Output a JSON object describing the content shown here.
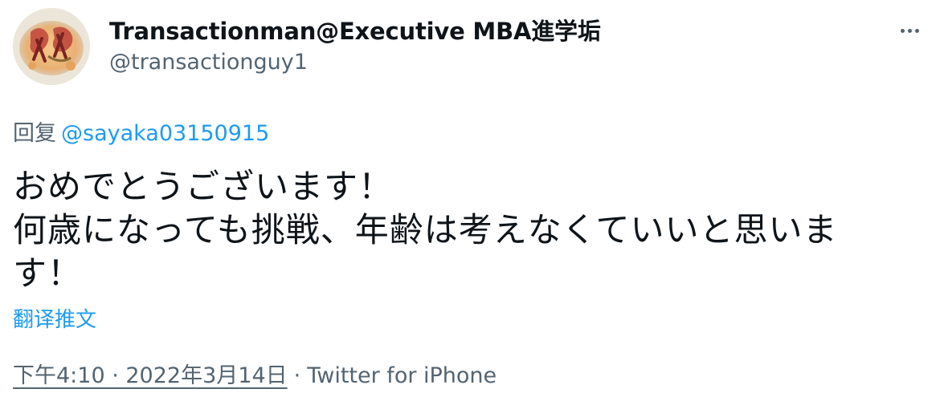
{
  "author": {
    "display_name": "Transactionman@Executive MBA進学垢",
    "handle": "@transactionguy1",
    "avatar_icon": "avatar-icon"
  },
  "more_icon": "more-options-icon",
  "reply": {
    "prefix": "回复",
    "mention": "@sayaka03150915"
  },
  "tweet": {
    "lines": [
      "おめでとうございます！",
      "何歳になっても挑戦、年齢は考えなくていいと思いま",
      "す！"
    ],
    "translate_label": "翻译推文"
  },
  "meta": {
    "timestamp": "下午4:10 · 2022年3月14日",
    "separator": "·",
    "source": "Twitter for iPhone"
  },
  "colors": {
    "text_primary": "#0f1419",
    "text_secondary": "#536471",
    "link": "#1d9bf0"
  }
}
